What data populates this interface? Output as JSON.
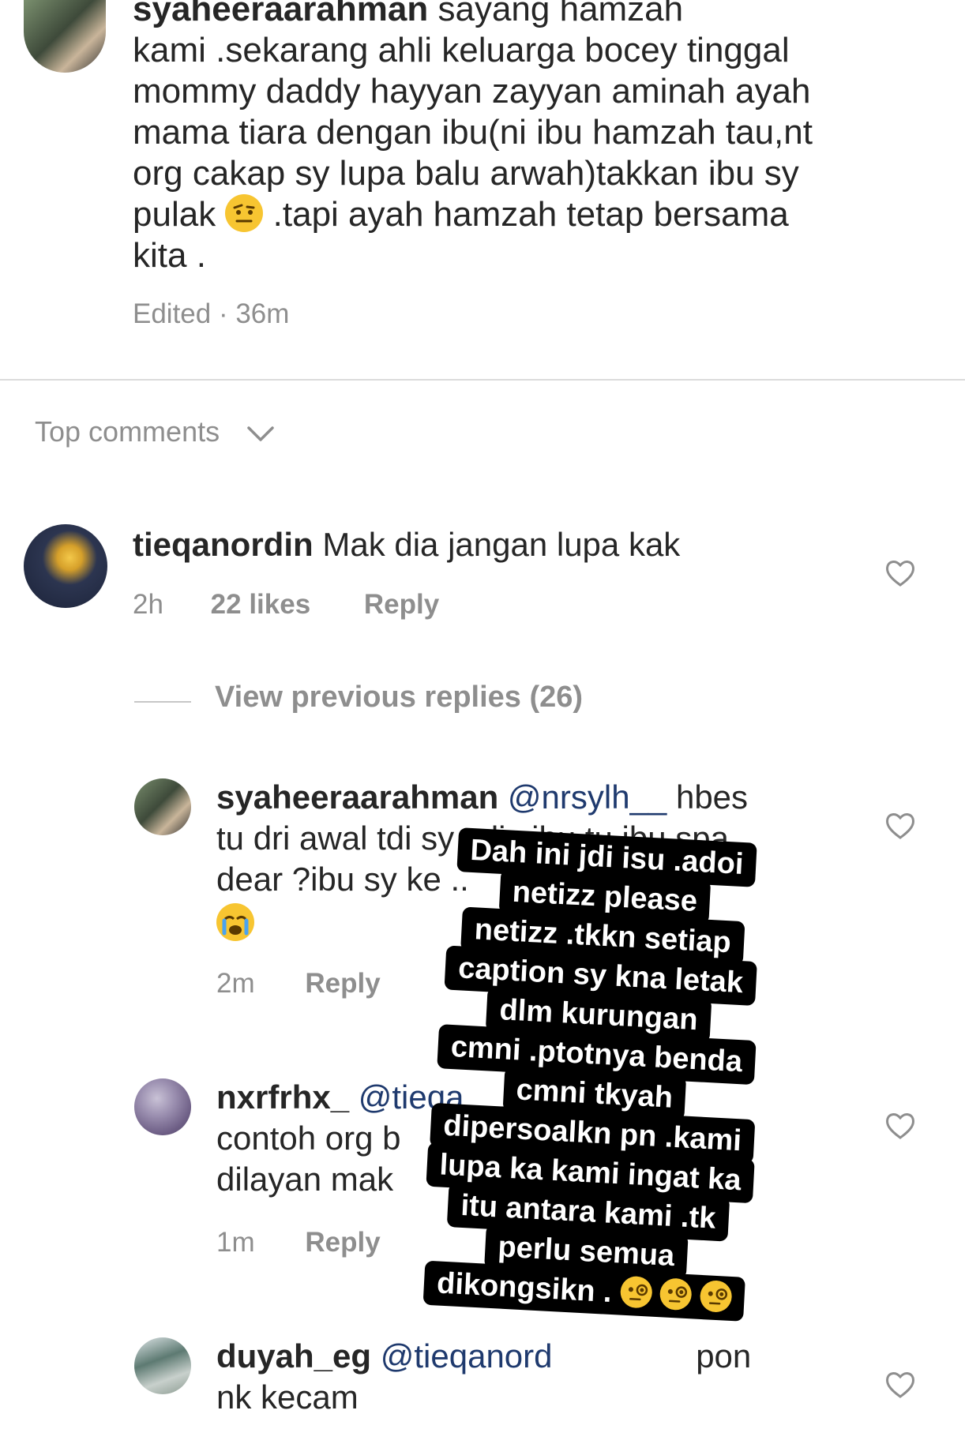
{
  "caption": {
    "username": "syaheeraarahman",
    "text_line1": "sayang hamzah",
    "text_line2": "kami .sekarang ahli keluarga bocey tinggal",
    "text_line3": "mommy daddy hayyan zayyan aminah ayah",
    "text_line4": "mama tiara dengan ibu(ni ibu hamzah tau,nt",
    "text_line5": "org cakap sy lupa balu arwah)takkan ibu sy",
    "text_line6a": "pulak",
    "text_line6b": ".tapi ayah hamzah tetap bersama",
    "text_line7": "kita .",
    "meta": "Edited · 36m"
  },
  "sort": {
    "label": "Top comments"
  },
  "comments": [
    {
      "username": "tieqanordin",
      "text": "Mak dia jangan lupa kak",
      "time": "2h",
      "likes": "22 likes",
      "reply": "Reply"
    }
  ],
  "view_previous": "View previous replies (26)",
  "replies": [
    {
      "username": "syaheeraarahman",
      "mention": "@nrsylh__",
      "text_line1_tail": "hbes",
      "text_line2": "tu dri awal tdi sy tulis ibu tu ibu spa",
      "text_line3": "dear ?ibu sy ke ..",
      "time": "2m",
      "reply": "Reply"
    },
    {
      "username": "nxrfrhx_",
      "mention": "@tieqa",
      "text_line2": "contoh org b",
      "text_line3": "dilayan mak",
      "time": "1m",
      "reply": "Reply"
    },
    {
      "username": "duyah_eg",
      "mention": "@tieqanord",
      "text_line1_tail": "pon",
      "text_line2": "nk kecam"
    }
  ],
  "sticker": {
    "lines": [
      "Dah ini jdi isu .adoi",
      "netizz please",
      "netizz .tkkn setiap",
      "caption sy kna letak",
      "dlm kurungan",
      "cmni .ptotnya benda",
      "cmni tkyah",
      "dipersoalkn pn .kami",
      "lupa ka kami ingat ka",
      "itu antara kami .tk",
      "perlu semua",
      "dikongsikn ."
    ]
  },
  "icons": {
    "heart": "heart-outline-icon",
    "chevron": "chevron-down-icon"
  },
  "colors": {
    "text": "#262626",
    "secondary": "#8e8e8e",
    "mention": "#1f3a6e",
    "sticker_bg": "#000000"
  }
}
